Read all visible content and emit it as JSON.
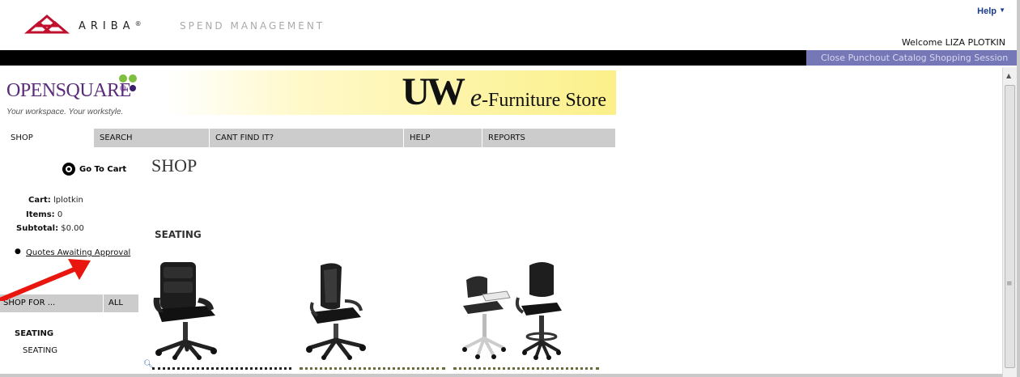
{
  "ariba": {
    "brand": "ARIBA",
    "reg": "®",
    "product": "SPEND MANAGEMENT",
    "help": "Help",
    "welcome": "Welcome LIZA PLOTKIN",
    "close_session": "Close Punchout Catalog Shopping Session"
  },
  "store": {
    "os_logo": "OPENSQUARE",
    "os_tagline": "Your workspace. Your workstyle.",
    "uw_logo": "UW",
    "store_title_e": "e",
    "store_title_rest": "-Furniture Store"
  },
  "nav": {
    "tabs": [
      {
        "label": "SHOP"
      },
      {
        "label": "SEARCH"
      },
      {
        "label": "CANT FIND IT?"
      },
      {
        "label": "HELP"
      },
      {
        "label": "REPORTS"
      }
    ]
  },
  "sidebar": {
    "go_to_cart": "Go To Cart",
    "cart_label": "Cart:",
    "cart_value": "lplotkin",
    "items_label": "Items:",
    "items_value": "0",
    "subtotal_label": "Subtotal:",
    "subtotal_value": "$0.00",
    "quotes_link": "Quotes Awaiting Approval",
    "shop_for": "SHOP FOR ...",
    "all": "ALL",
    "category": "SEATING",
    "subcategory": "SEATING"
  },
  "main": {
    "title": "SHOP",
    "section": "SEATING",
    "products": [
      {
        "icon": "executive-leather-chair"
      },
      {
        "icon": "mesh-task-chair"
      },
      {
        "icon": "training-and-drafting-chairs"
      }
    ]
  },
  "colors": {
    "close_bar": "#7577b6",
    "nav_bg": "#cccccc",
    "banner_yellow": "#fbf08a",
    "annotation_arrow": "#e8160e"
  }
}
